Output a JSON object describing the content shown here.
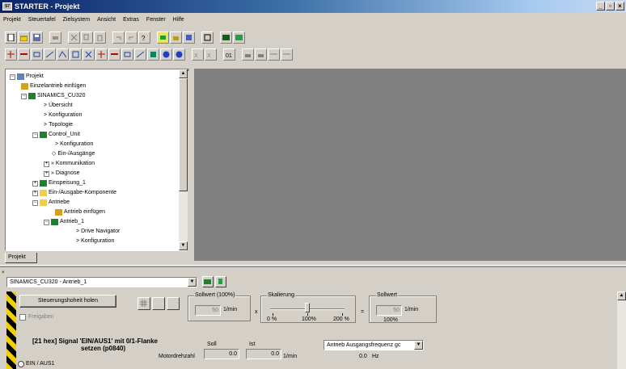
{
  "window": {
    "title": "STARTER - Projekt"
  },
  "menu": [
    "Projekt",
    "Steuertafel",
    "Zielsystem",
    "Ansicht",
    "Extras",
    "Fenster",
    "Hilfe"
  ],
  "tree": {
    "tab_label": "Projekt",
    "nodes": [
      {
        "label": "Projekt",
        "pm": "−"
      },
      {
        "label": "Einzelantrieb einfügen",
        "pm": ""
      },
      {
        "label": "SINAMICS_CU320",
        "pm": "−"
      },
      {
        "label": "Übersicht",
        "pm": ""
      },
      {
        "label": "Konfiguration",
        "pm": ""
      },
      {
        "label": "Topologie",
        "pm": ""
      },
      {
        "label": "Control_Unit",
        "pm": "−"
      },
      {
        "label": "Konfiguration",
        "pm": ""
      },
      {
        "label": "Ein-/Ausgänge",
        "pm": ""
      },
      {
        "label": "Kommunikation",
        "pm": "+"
      },
      {
        "label": "Diagnose",
        "pm": "+"
      },
      {
        "label": "Einspeisung_1",
        "pm": "+"
      },
      {
        "label": "Ein-/Ausgabe-Komponente",
        "pm": "+"
      },
      {
        "label": "Antriebe",
        "pm": "−"
      },
      {
        "label": "Antrieb einfügen",
        "pm": ""
      },
      {
        "label": "Antrieb_1",
        "pm": "−"
      },
      {
        "label": "Drive Navigator",
        "pm": ""
      },
      {
        "label": "Konfiguration",
        "pm": ""
      }
    ]
  },
  "control_panel": {
    "drive_select": "SINAMICS_CU320 - Antrieb_1",
    "control_button": "Steuerungshoheit holen",
    "enable_label": "Freigaben",
    "setpoint100_label": "Sollwert (100%)",
    "setpoint100_value": "50",
    "setpoint100_unit": "1/min",
    "times": "x",
    "scaling_label": "Skalierung",
    "scale_ticks": [
      "0 %",
      "100%",
      "200 %"
    ],
    "scale_percent": 100,
    "equals": "=",
    "setpoint_label": "Sollwert",
    "setpoint_value": "50",
    "setpoint_unit": "1/min",
    "setpoint_percent": "100%",
    "signal_line1": "[21 hex] Signal 'EIN/AUS1' mit 0/1-Flanke",
    "signal_line2": "setzen (p0840)",
    "soll_label": "Soll",
    "ist_label": "Ist",
    "motor_speed_label": "Motordrehzahl",
    "soll_value": "0.0",
    "ist_value": "0.0",
    "speed_unit": "1/min",
    "freq_select": "Antrieb Ausgangsfrequenz gc",
    "freq_value": "0.0",
    "freq_unit": "Hz",
    "on_off_label": "EIN / AUS1"
  }
}
